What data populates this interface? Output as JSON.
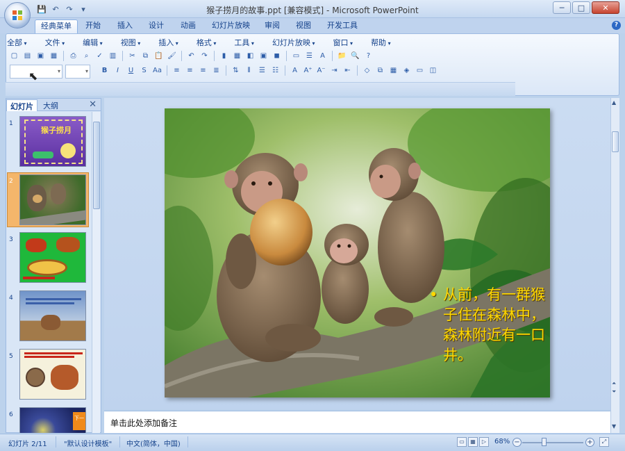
{
  "window": {
    "title": "猴子捞月的故事.ppt [兼容模式] - Microsoft PowerPoint",
    "minimize": "─",
    "maximize": "□",
    "close": "✕"
  },
  "qat": [
    "💾",
    "↶",
    "↷",
    "▾"
  ],
  "ribbon_tabs": [
    "经典菜单",
    "开始",
    "插入",
    "设计",
    "动画",
    "幻灯片放映",
    "审阅",
    "视图",
    "开发工具"
  ],
  "ribbon_tabs_active": 0,
  "menus": [
    "全部",
    "文件",
    "编辑",
    "视图",
    "插入",
    "格式",
    "工具",
    "幻灯片放映",
    "窗口",
    "帮助"
  ],
  "pane": {
    "tab_slides": "幻灯片",
    "tab_outline": "大纲",
    "close": "✕",
    "slides": [
      {
        "num": "1",
        "title": "猴子捞月"
      },
      {
        "num": "2",
        "title": ""
      },
      {
        "num": "3",
        "title": ""
      },
      {
        "num": "4",
        "title": ""
      },
      {
        "num": "5",
        "title": ""
      },
      {
        "num": "6",
        "title": "下一"
      }
    ],
    "selected": 1
  },
  "slide": {
    "bullet_marker": "•",
    "bullet_text": "从前，有一群猴子住在森林中，森林附近有一口井。"
  },
  "notes": {
    "placeholder": "单击此处添加备注"
  },
  "status": {
    "slide_info": "幻灯片 2/11",
    "theme": "\"默认设计模板\"",
    "language": "中文(简体，中国)",
    "zoom": "68%"
  },
  "colors": {
    "accent": "#15428b",
    "bullet_text": "#ffd800",
    "selection": "#f4b66b"
  }
}
